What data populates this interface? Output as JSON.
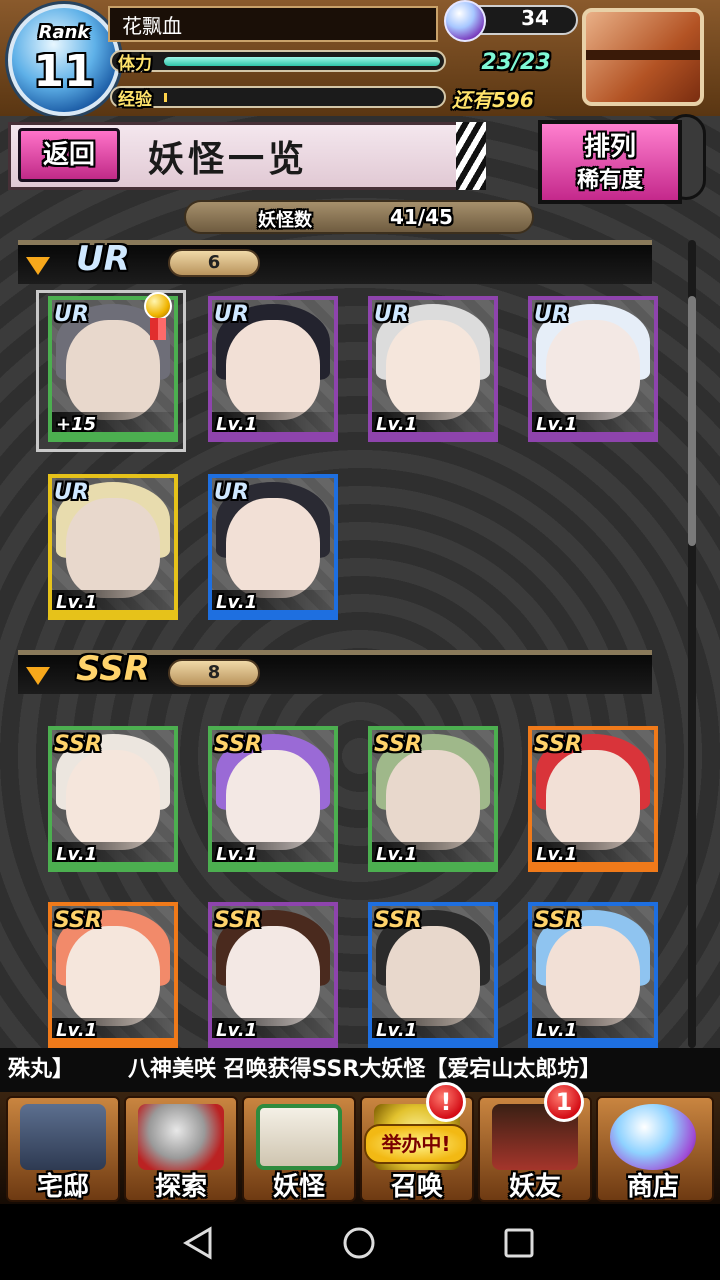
{
  "header": {
    "rank_label": "Rank",
    "rank_value": "11",
    "player_name": "花飘血",
    "stamina_label": "体力",
    "stamina_value": "23/23",
    "stamina_fraction": 1.0,
    "exp_label": "经验",
    "exp_fraction": 0.01,
    "remaining_label": "还有596",
    "gem_count": "34"
  },
  "page": {
    "back_label": "返回",
    "title": "妖怪一览",
    "sort_title": "排列",
    "sort_value": "稀有度",
    "count_label": "妖怪数",
    "count_value": "41/45"
  },
  "sections": [
    {
      "rarity": "UR",
      "count": "6",
      "cards": [
        {
          "badge": "UR",
          "level": "+15",
          "frame": "#4caf50"
        },
        {
          "badge": "UR",
          "level": "Lv.1",
          "frame": "#8e44ad"
        },
        {
          "badge": "UR",
          "level": "Lv.1",
          "frame": "#8e44ad"
        },
        {
          "badge": "UR",
          "level": "Lv.1",
          "frame": "#8e44ad"
        },
        {
          "badge": "UR",
          "level": "Lv.1",
          "frame": "#e6c21a"
        },
        {
          "badge": "UR",
          "level": "Lv.1",
          "frame": "#1e6fe0"
        }
      ]
    },
    {
      "rarity": "SSR",
      "count": "8",
      "cards": [
        {
          "badge": "SSR",
          "level": "Lv.1",
          "frame": "#4caf50"
        },
        {
          "badge": "SSR",
          "level": "Lv.1",
          "frame": "#4caf50"
        },
        {
          "badge": "SSR",
          "level": "Lv.1",
          "frame": "#4caf50"
        },
        {
          "badge": "SSR",
          "level": "Lv.1",
          "frame": "#f07a1a"
        },
        {
          "badge": "SSR",
          "level": "Lv.1",
          "frame": "#f07a1a"
        },
        {
          "badge": "SSR",
          "level": "Lv.1",
          "frame": "#8e44ad"
        },
        {
          "badge": "SSR",
          "level": "Lv.1",
          "frame": "#1e6fe0"
        },
        {
          "badge": "SSR",
          "level": "Lv.1",
          "frame": "#1e6fe0"
        }
      ]
    }
  ],
  "ticker": {
    "left_text": "殊丸】",
    "main_text": "八神美咲 召唤获得SSR大妖怪【爱宕山太郎坊】"
  },
  "nav": {
    "items": [
      "宅邸",
      "探索",
      "妖怪",
      "召唤",
      "妖友",
      "商店"
    ],
    "summon_tag": "举办中!",
    "summon_alert": "!",
    "friend_alert": "1"
  },
  "icons": {
    "gem": "gem-icon",
    "chest": "treasure-chest-icon",
    "medal": "medal-icon",
    "back": "triangle-back-icon",
    "home": "circle-home-icon",
    "recent": "square-recent-icon"
  }
}
